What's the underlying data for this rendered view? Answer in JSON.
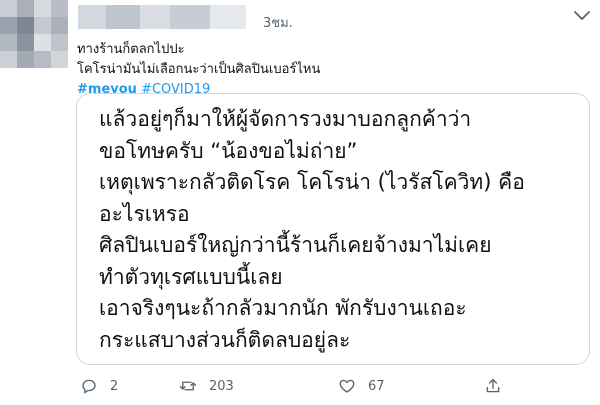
{
  "tweet": {
    "timestamp": "3ชม.",
    "text_lines": [
      "ทางร้านก็ตลกไปปะ",
      "โคโรน่ามันไม่เลือกนะว่าเป็นศิลปินเบอร์ไหน"
    ],
    "hashtags": [
      "#meyou",
      "#COVID19"
    ],
    "image_text_lines": [
      "แล้วอยู่ๆก็มาให้ผู้จัดการวงมาบอกลูกค้าว่า",
      "ขอโทษครับ “น้องขอไม่ถ่าย”",
      "เหตุเพราะกลัวติดโรค โคโรน่า (ไวรัสโควิท) คือ",
      "อะไรเหรอ",
      "ศิลปินเบอร์ใหญ่กว่านี้ร้านก็เคยจ้างมาไม่เคย",
      "ทำตัวทุเรศแบบนี้เลย",
      "เอาจริงๆนะถ้ากลัวมากนัก พักรับงานเถอะ",
      "กระแสบางส่วนก็ติดลบอยู่ละ"
    ],
    "actions": {
      "reply": {
        "icon": "reply-icon",
        "count": "2"
      },
      "retweet": {
        "icon": "retweet-icon",
        "count": "203"
      },
      "like": {
        "icon": "heart-icon",
        "count": "67"
      },
      "share": {
        "icon": "share-icon"
      }
    },
    "more_icon": "more-icon",
    "colors": {
      "link": "#1d9bf0",
      "text": "#0f1419",
      "muted": "#536471",
      "border": "#cfd9de"
    }
  }
}
